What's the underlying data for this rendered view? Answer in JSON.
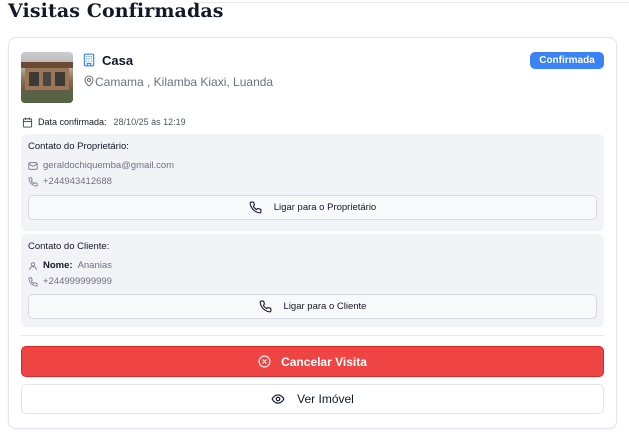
{
  "page": {
    "title": "Visitas Confirmadas"
  },
  "visit": {
    "property_type": "Casa",
    "location": "Camama , Kilamba Kiaxi, Luanda",
    "status_badge": "Confirmada",
    "date_label": "Data confirmada:",
    "date_value": "28/10/25 às 12:19"
  },
  "owner_contact": {
    "title": "Contato do Proprietário:",
    "email": "geraldochiquemba@gmail.com",
    "phone": "+244943412688",
    "call_label": "Ligar para o Proprietário"
  },
  "client_contact": {
    "title": "Contato do Cliente:",
    "name_label": "Nome:",
    "name_value": "Ananias",
    "phone": "+244999999999",
    "call_label": "Ligar para o Cliente"
  },
  "actions": {
    "cancel_label": "Cancelar Visita",
    "view_label": "Ver Imóvel"
  },
  "colors": {
    "badge": "#3b82f6",
    "cancel": "#ef4444",
    "panel": "#f1f3f7"
  },
  "icons": {
    "property": "building-icon",
    "location": "map-pin-icon",
    "date": "calendar-icon",
    "email": "mail-icon",
    "phone": "phone-icon",
    "user": "user-icon",
    "cancel": "x-circle-icon",
    "view": "eye-icon"
  }
}
